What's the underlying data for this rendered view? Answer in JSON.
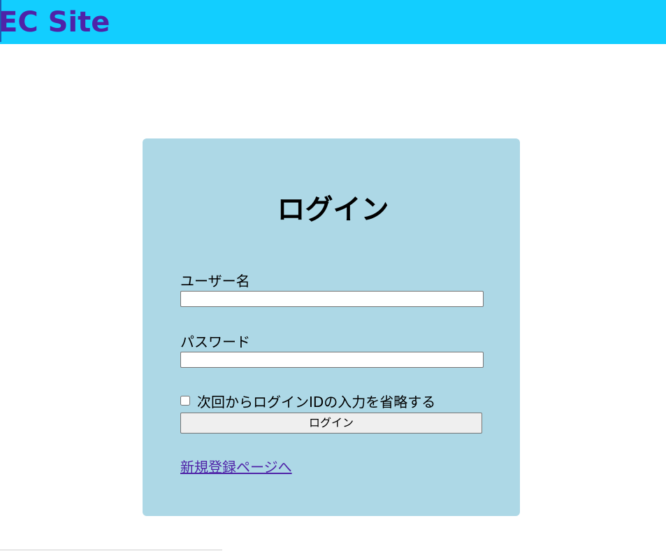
{
  "header": {
    "site_title": "EC Site"
  },
  "login": {
    "title": "ログイン",
    "username_label": "ユーザー名",
    "username_value": "",
    "password_label": "パスワード",
    "password_value": "",
    "remember_label": "次回からログインIDの入力を省略する",
    "remember_checked": false,
    "submit_label": "ログイン",
    "register_link": "新規登録ページへ"
  },
  "colors": {
    "header_bg": "#12ceff",
    "title_color": "#4f23a8",
    "panel_bg": "#add8e6",
    "link_color": "#4f23a8",
    "button_bg": "#efefef"
  }
}
